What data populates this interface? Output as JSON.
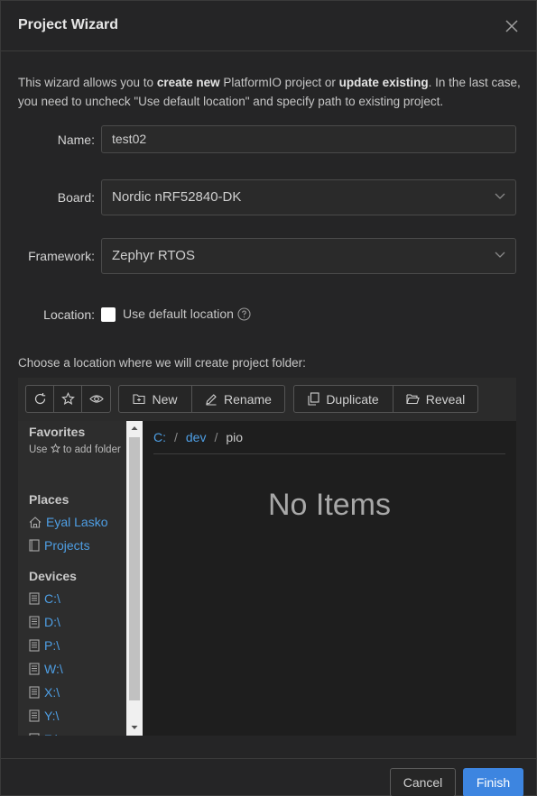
{
  "dialog": {
    "title": "Project Wizard",
    "intro": {
      "p1": "This wizard allows you to ",
      "b1": "create new",
      "p2": " PlatformIO project or ",
      "b2": "update existing",
      "p3": ". In the last case, you need to uncheck \"Use default location\" and specify path to existing project."
    }
  },
  "form": {
    "name_label": "Name",
    "name_value": "test02",
    "board_label": "Board",
    "board_value": "Nordic nRF52840-DK",
    "framework_label": "Framework",
    "framework_value": "Zephyr RTOS",
    "location_label": "Location",
    "use_default_label": "Use default location",
    "use_default_checked": false
  },
  "browser": {
    "choose_text": "Choose a location where we will create project folder:",
    "toolbar": {
      "new_label": "New",
      "rename_label": "Rename",
      "duplicate_label": "Duplicate",
      "reveal_label": "Reveal"
    },
    "sidebar": {
      "favorites_title": "Favorites",
      "favorites_note_a": "Use",
      "favorites_note_b": "to add folder",
      "places_title": "Places",
      "places": [
        "Eyal Lasko",
        "Projects"
      ],
      "devices_title": "Devices",
      "devices": [
        "C:\\",
        "D:\\",
        "P:\\",
        "W:\\",
        "X:\\",
        "Y:\\",
        "Z:\\"
      ]
    },
    "breadcrumb": {
      "parts": [
        "C:",
        "dev"
      ],
      "separator": "/",
      "current": "pio"
    },
    "empty_text": "No Items"
  },
  "footer": {
    "cancel_label": "Cancel",
    "finish_label": "Finish"
  },
  "colors": {
    "accent": "#3d85e0",
    "link": "#4e9fe5",
    "background": "#252526"
  }
}
